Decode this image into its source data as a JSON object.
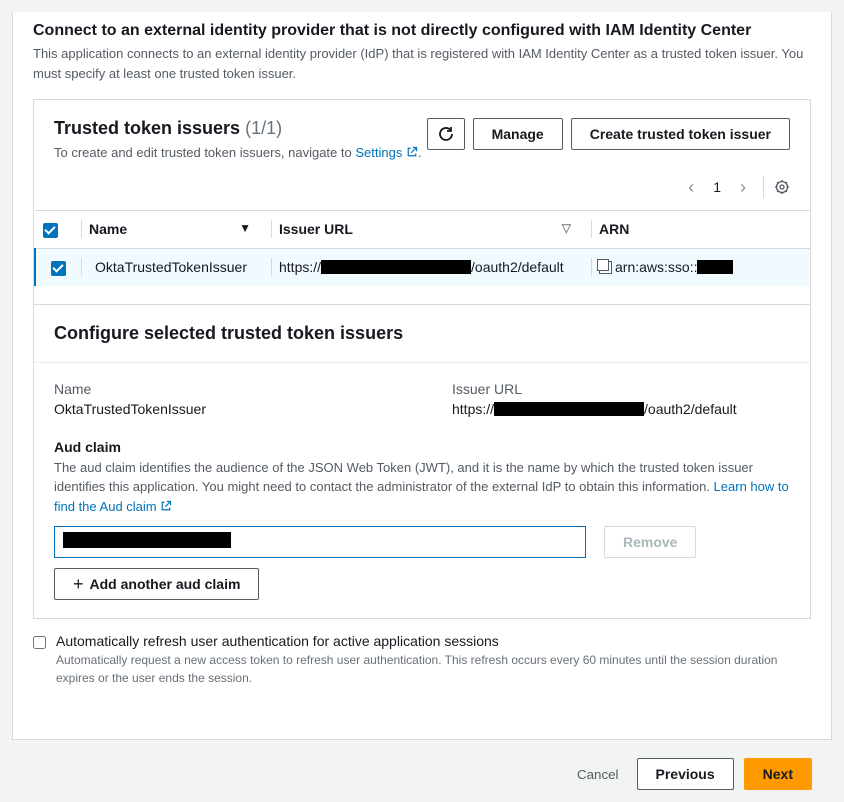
{
  "header": {
    "title": "Connect to an external identity provider that is not directly configured with IAM Identity Center",
    "description": "This application connects to an external identity provider (IdP) that is registered with IAM Identity Center as a trusted token issuer. You must specify at least one trusted token issuer."
  },
  "issuers_card": {
    "title_prefix": "Trusted token issuers",
    "count": "(1/1)",
    "subtitle_prefix": "To create and edit trusted token issuers, navigate to ",
    "settings_link": "Settings",
    "refresh_label": "Refresh",
    "manage_label": "Manage",
    "create_label": "Create trusted token issuer",
    "pagination": {
      "page": "1"
    },
    "columns": {
      "name": "Name",
      "issuer_url": "Issuer URL",
      "arn": "ARN"
    },
    "rows": [
      {
        "name": "OktaTrustedTokenIssuer",
        "url_prefix": "https://",
        "url_suffix": "/oauth2/default",
        "arn_prefix": "arn:aws:sso::"
      }
    ]
  },
  "configure": {
    "title": "Configure selected trusted token issuers",
    "name_label": "Name",
    "name_value": "OktaTrustedTokenIssuer",
    "issuer_url_label": "Issuer URL",
    "issuer_url_prefix": "https://",
    "issuer_url_suffix": "/oauth2/default",
    "aud_label": "Aud claim",
    "aud_desc_prefix": "The aud claim identifies the audience of the JSON Web Token (JWT), and it is the name by which the trusted token issuer identifies this application. You might need to contact the administrator of the external IdP to obtain this information. ",
    "aud_link": "Learn how to find the Aud claim",
    "remove_label": "Remove",
    "add_another_label": "Add another aud claim"
  },
  "auto_refresh": {
    "title": "Automatically refresh user authentication for active application sessions",
    "desc": "Automatically request a new access token to refresh user authentication. This refresh occurs every 60 minutes until the session duration expires or the user ends the session."
  },
  "footer": {
    "cancel": "Cancel",
    "previous": "Previous",
    "next": "Next"
  }
}
